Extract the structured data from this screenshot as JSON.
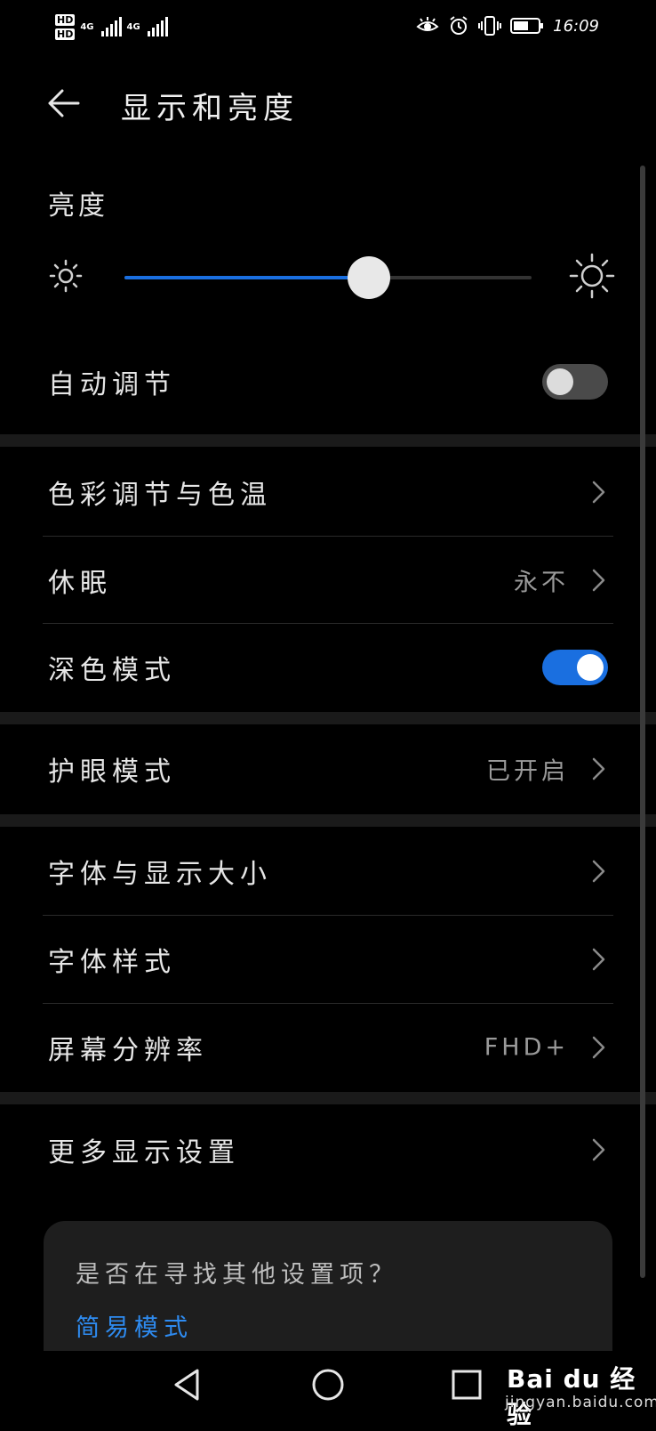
{
  "status_bar": {
    "sim1": "HD",
    "sim2": "HD",
    "network1": "4G",
    "network2": "4G",
    "battery": "52",
    "time": "16:09",
    "icons": [
      "eye-comfort-icon",
      "alarm-icon",
      "vibrate-icon",
      "battery-icon"
    ]
  },
  "app_bar": {
    "title": "显示和亮度"
  },
  "brightness": {
    "label": "亮度",
    "level": 0.6
  },
  "auto_adjust": {
    "label": "自动调节",
    "enabled": false
  },
  "items": {
    "color": {
      "label": "色彩调节与色温"
    },
    "sleep": {
      "label": "休眠",
      "value": "永不"
    },
    "dark_mode": {
      "label": "深色模式",
      "enabled": true
    },
    "eye_comfort": {
      "label": "护眼模式",
      "value": "已开启"
    },
    "font_size": {
      "label": "字体与显示大小"
    },
    "font_style": {
      "label": "字体样式"
    },
    "resolution": {
      "label": "屏幕分辨率",
      "value": "FHD+"
    },
    "more": {
      "label": "更多显示设置"
    }
  },
  "suggestion": {
    "question": "是否在寻找其他设置项？",
    "link": "简易模式"
  },
  "watermark": {
    "brand": "Bai du 经验",
    "site": "jingyan.baidu.com"
  },
  "colors": {
    "accent": "#1a6fe0",
    "link": "#2e8bf0",
    "background": "#000000"
  }
}
